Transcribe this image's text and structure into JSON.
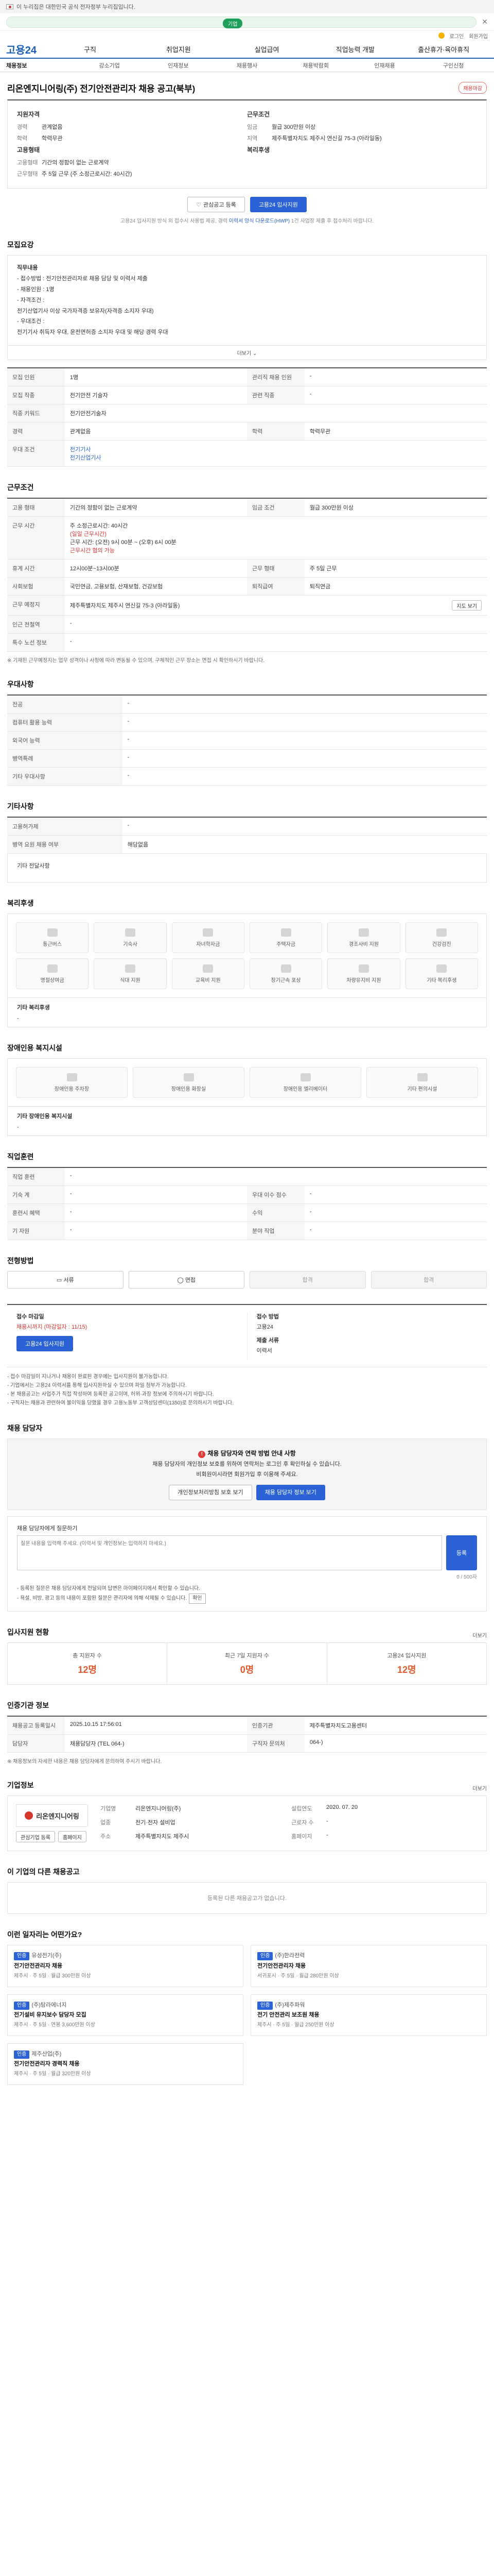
{
  "gov": {
    "text": "이 누리집은 대한민국 공식 전자정부 누리집입니다."
  },
  "header": {
    "pill_label": "기업",
    "util": [
      "로그인",
      "회원가입"
    ]
  },
  "gnb": {
    "logo": "고용24",
    "items": [
      "구직",
      "취업지원",
      "실업급여",
      "직업능력 개발",
      "출산휴가·육아휴직"
    ]
  },
  "lnb": [
    "채용정보",
    "강소기업",
    "인재정보",
    "채용행사",
    "채용박람회",
    "인재채용",
    "구인신청"
  ],
  "title": {
    "text": "리온엔지니어링(주) 전기안전관리자 채용 공고(북부)",
    "badge": "채용마감"
  },
  "summary": {
    "qual_head": "지원자격",
    "career_k": "경력",
    "career_v": "관계없음",
    "edu_k": "학력",
    "edu_v": "학력무관",
    "cond_head": "근무조건",
    "pay_k": "임금",
    "pay_v": "월급 300만원 이상",
    "loc_k": "지역",
    "loc_v": "제주특별자치도 제주시 연신길 75-3 (아라일동)",
    "type_head": "고용형태",
    "type_k": "고용형태",
    "type_v": "기간의 정함이 없는 근로계약",
    "hours_k": "근무형태",
    "hours_v": "주 5일 근무 (주 소정근로시간: 40시간)",
    "welfare_head": "복리후생"
  },
  "actions": {
    "scrap": "관심공고 등록",
    "apply": "고용24 입사지원"
  },
  "note": {
    "pre": "고용24 입사지원 방식 외 접수시 사용법 제공, 경력 ",
    "hl": "이력서 양식 다운로드(HWP)",
    "post": " 1건 사업장 제출 후 접수처리 바랍니다."
  },
  "duty": {
    "head": "모집요강",
    "lines": [
      "직무내용",
      "- 접수방법 : 전기안전관리자로 채용 담당 및 이력서 제출",
      "- 채용인원 : 1명",
      "- 자격조건 :",
      "   전기산업기사 이상 국가자격증 보유자(자격증 소지자 우대)",
      "- 우대조건 :",
      "   전기기사 취득자 우대, 운전면허증 소지자 우대 및 해당 경력 우대"
    ],
    "more": "더보기"
  },
  "job": {
    "r1": {
      "k1": "모집 인원",
      "v1": "1명",
      "k2": "관리직 채용 인원",
      "v2": "-"
    },
    "r2": {
      "k1": "모집 직종",
      "v1": "전기안전 기술자",
      "k2": "관련 직종",
      "v2": "-"
    },
    "r3": {
      "k1": "직종 키워드",
      "v1": "전기안전기술자"
    },
    "r4": {
      "k1": "경력",
      "v1": "관계없음",
      "k2": "학력",
      "v2": "학력무관"
    },
    "r5": {
      "k1": "우대 조건",
      "v1": "전기기사",
      "v2": "전기산업기사"
    }
  },
  "work": {
    "head": "근무조건",
    "r1": {
      "k1": "고용 형태",
      "v1": "기간의 정함이 없는 근로계약",
      "k2": "임금 조건",
      "v2": "월급 300만원 이상"
    },
    "r2": {
      "k1": "근무 시간",
      "v1a": "주 소정근로시간: 40시간",
      "v1b": "(일일 근무시간)",
      "v1c": "근무 시간: (오전) 9시 00분 ~ (오후) 6시 00분",
      "v1d": "근무시간 협의 가능"
    },
    "r3": {
      "k1": "휴게 시간",
      "v1": "12시00분~13시00분",
      "k2": "근무 형태",
      "v2": "주 5일 근무"
    },
    "r4": {
      "k1": "사회보험",
      "v1": "국민연금, 고용보험, 산재보험, 건강보험",
      "k2": "퇴직급여",
      "v2": "퇴직연금"
    },
    "r5": {
      "k1": "근무 예정지",
      "v1": "제주특별자치도 제주시 연신길 75-3 (아라일동)",
      "btn": "지도 보기"
    },
    "r6": {
      "k1": "인근 전철역",
      "v1": "-"
    },
    "r7": {
      "k1": "특수 노선 정보",
      "v1": "-"
    },
    "fn": "※ 기재된 근무예정지는 업무 성격이나 사정에 따라 변동될 수 있으며, 구체적인 근무 장소는 면접 시 확인하시기 바랍니다."
  },
  "pref": {
    "head": "우대사항",
    "rows": [
      {
        "k": "전공",
        "v": "-"
      },
      {
        "k": "컴퓨터 활용 능력",
        "v": "-"
      },
      {
        "k": "외국어 능력",
        "v": "-"
      },
      {
        "k": "병역특례",
        "v": "-"
      },
      {
        "k": "기타 우대사항",
        "v": "-"
      }
    ]
  },
  "etc": {
    "head": "기타사항",
    "rows": [
      {
        "k": "고용허가제",
        "v": "-"
      },
      {
        "k": "병역 요원 채용 여부",
        "v": "해당없음"
      }
    ],
    "extra_k": "기타 전달사항"
  },
  "welfare": {
    "head": "복리후생",
    "items": [
      "통근버스",
      "기숙사",
      "자녀학자금",
      "주택자금",
      "경조사비 지원",
      "건강검진",
      "명절상여금",
      "식대 지원",
      "교육비 지원",
      "장기근속 포상",
      "차량유지비 지원",
      "기타 복리후생"
    ],
    "extra_k": "기타 복리후생"
  },
  "disab": {
    "head": "장애인용 복지시설",
    "items": [
      "장애인용 주차장",
      "장애인용 화장실",
      "장애인용 엘리베이터",
      "기타 편의시설"
    ],
    "extra_k": "기타 장애인용 복지시설"
  },
  "prefer2": {
    "head": "직업훈련",
    "r1": {
      "k1": "직업 훈련",
      "v1": "-"
    },
    "r2": {
      "k1": "기숙 계",
      "v1": "-",
      "k2": "우대 이수 점수",
      "v2": "-"
    },
    "r3": {
      "k1": "훈련시 혜택",
      "v1": "-",
      "k2": "수익",
      "v2": "-"
    },
    "r4": {
      "k1": "기 자원",
      "v1": "-",
      "k2": "분야 직업",
      "v2": "-"
    }
  },
  "process": {
    "head": "전형방법",
    "steps": [
      "서류",
      "면접",
      "합격",
      "합격"
    ]
  },
  "apply": {
    "period_k": "접수 마감일",
    "period_v": "채용시까지 (마감일자 : 11/15)",
    "method_k": "접수 방법",
    "method_v": "고용24",
    "btn": "고용24 입사지원",
    "docs_k": "제출 서류",
    "docs_v": "이력서",
    "bullets": [
      "- 접수 마감일이 지나거나 채용이 완료된 경우에는 입사지원이 불가능합니다.",
      "- 기업에서는 고용24 이력서를 통해 입사지원하실 수 있으며 파일 첨부가 가능합니다.",
      "- 본 채용공고는 사업주가 직접 작성하여 등록한 공고이며, 허위·과장 정보에 주의하시기 바랍니다.",
      "- 구직자는 채용과 관련하여 불이익을 당했을 경우 고용노동부 고객상담센터(1350)로 문의하시기 바랍니다."
    ]
  },
  "qa": {
    "head": "채용 담당자",
    "alert_head": "채용 담당자와 연락 방법 안내 사항",
    "alert_body": "채용 담당자의 개인정보 보호를 위하여 연락처는 로그인 후 확인하실 수 있습니다.",
    "alert_body2": "비회원이시라면 회원가입 후 이용해 주세요.",
    "b1": "개인정보처리방침 보호 보기",
    "b2": "채용 담당자 정보 보기",
    "q_title": "채용 담당자에게 질문하기",
    "q_cnt": "0 / 500자",
    "q_placeholder": "질문 내용을 입력해 주세요. (이력서 및 개인정보는 입력하지 마세요.)",
    "q_btn": "등록",
    "q_list": [
      "- 등록된 질문은 채용 담당자에게 전달되며 답변은 마이페이지에서 확인할 수 있습니다.",
      "- 욕설, 비방, 광고 등의 내용이 포함된 질문은 관리자에 의해 삭제될 수 있습니다."
    ],
    "q_mini": "확인"
  },
  "stats": {
    "head": "입사지원 현황",
    "more": "더보기",
    "items": [
      {
        "l": "총 지원자 수",
        "n": "12명"
      },
      {
        "l": "최근 7일 지원자 수",
        "n": "0명"
      },
      {
        "l": "고용24 입사지원",
        "n": "12명"
      }
    ]
  },
  "infoRow": {
    "head": "인증기관 정보",
    "r1": {
      "k1": "채용공고 등록일시",
      "v1": "2025.10.15 17:56:01",
      "k2": "인증기관",
      "v2": "제주특별자치도고용센터"
    },
    "r2": {
      "k1": "담당자",
      "v1": "채용담당자 (TEL 064-)",
      "k2": "구직자 문의처",
      "v2": "064-)"
    },
    "fn": "※ 채용정보의 자세한 내용은 채용 담당자에게 문의하여 주시기 바랍니다."
  },
  "corp": {
    "head": "기업정보",
    "more": "더보기",
    "logo": "리온엔지니어링",
    "b1": "관심기업 등록",
    "b2": "홈페이지",
    "f1k": "기업명",
    "f1v": "리온엔지니어링(주)",
    "f2k": "설립연도",
    "f2v": "2020. 07. 20",
    "f3k": "업종",
    "f3v": "전기·전자 설비업",
    "f4k": "근로자 수",
    "f4v": "-",
    "f5k": "주소",
    "f5v": "제주특별자치도 제주시",
    "f6k": "홈페이지",
    "f6v": "-"
  },
  "others": {
    "head": "이 기업의 다른 채용공고",
    "empty": "등록된 다른 채용공고가 없습니다."
  },
  "reco": {
    "head": "이런 일자리는 어떤가요?",
    "items": [
      {
        "tag": "인증",
        "co": "유성전기(주)",
        "t": "전기안전관리자 채용",
        "m": "제주시 · 주 5일 · 월급 300만원 이상"
      },
      {
        "tag": "인증",
        "co": "(주)한라전력",
        "t": "전기안전관리자 채용",
        "m": "서귀포시 · 주 5일 · 월급 280만원 이상"
      },
      {
        "tag": "인증",
        "co": "(주)탐라에너지",
        "t": "전기설비 유지보수 담당자 모집",
        "m": "제주시 · 주 5일 · 연봉 3,600만원 이상"
      },
      {
        "tag": "인증",
        "co": "(주)제주파워",
        "t": "전기 안전관리 보조원 채용",
        "m": "제주시 · 주 5일 · 월급 250만원 이상"
      },
      {
        "tag": "인증",
        "co": "제주산업(주)",
        "t": "전기안전관리자 경력직 채용",
        "m": "제주시 · 주 5일 · 월급 320만원 이상"
      }
    ]
  }
}
